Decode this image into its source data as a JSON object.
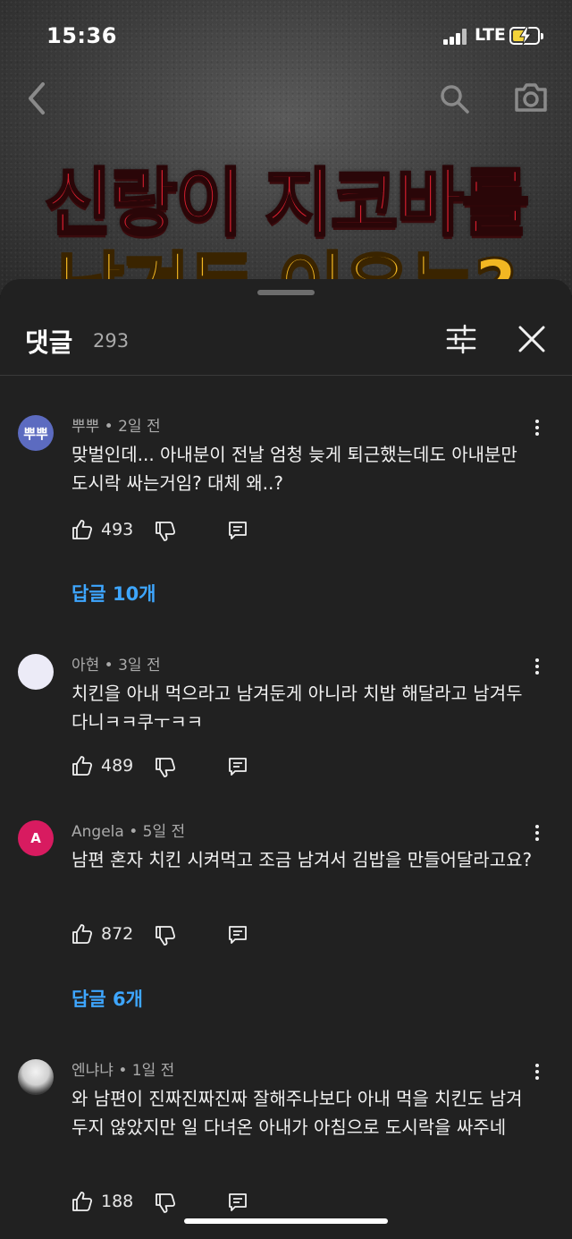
{
  "status_bar": {
    "time": "15:36",
    "network": "LTE"
  },
  "thumbnail": {
    "line1": "신랑이 지코바를",
    "line2": "남겨둔 이유는?"
  },
  "sheet": {
    "title": "댓글",
    "count": "293"
  },
  "comments": [
    {
      "avatar_text": "뿌뿌",
      "avatar_color": "#5c6bc0",
      "meta": "뿌뿌 • 2일 전",
      "text": "맞벌인데... 아내분이 전날 엄청 늦게 퇴근했는데도 아내분만 도시락 싸는거임? 대체 왜..?",
      "likes": "493",
      "replies": "답글 10개"
    },
    {
      "avatar_text": "",
      "avatar_color": "#ecebf7",
      "meta": "아현 • 3일 전",
      "text": "치킨을 아내 먹으라고 남겨둔게 아니라 치밥 해달라고 남겨두다니ㅋㅋ쿠ㅜㅋㅋ",
      "likes": "489"
    },
    {
      "avatar_text": "A",
      "avatar_color": "#d81b60",
      "meta": "Angela • 5일 전",
      "text": "남편 혼자 치킨 시켜먹고 조금 남겨서 김밥을 만들어달라고요?",
      "likes": "872",
      "replies": "답글 6개"
    },
    {
      "avatar_text": "",
      "avatar_color": "#cfcfcf",
      "meta": "엔냐냐 • 1일 전",
      "text": "와 남편이 진짜진짜진짜 잘해주나보다 아내 먹을 치킨도 남겨두지 않았지만 일 다녀온 아내가 아침으로 도시락을 싸주네",
      "likes": "188"
    }
  ],
  "icons": {
    "back": "chevron-left-icon",
    "search": "search-icon",
    "camera": "camera-icon",
    "filter": "filter-icon",
    "close": "close-icon",
    "more": "more-vert-icon",
    "like": "thumbs-up-icon",
    "dislike": "thumbs-down-icon",
    "reply": "reply-icon"
  },
  "colors": {
    "sheet_bg": "#212121",
    "link": "#3ea6ff",
    "meta": "#aaaaaa"
  }
}
